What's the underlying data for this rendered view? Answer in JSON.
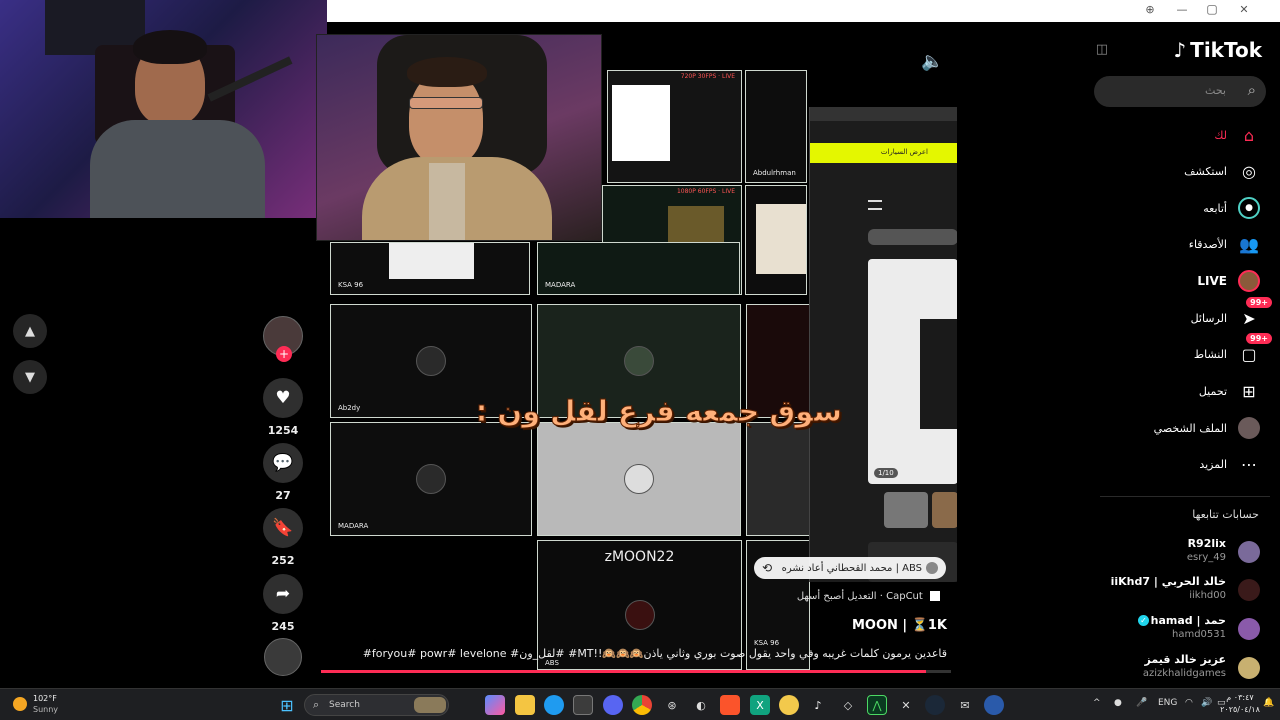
{
  "colors": {
    "accent": "#fe2c55",
    "sidebar_bg": "#000000",
    "taskbar_bg": "#1e1f22"
  },
  "window": {
    "controls": [
      "zoom-icon",
      "minimize-icon",
      "restore-icon",
      "close-icon"
    ]
  },
  "sidebar": {
    "logo": "TikTok",
    "search_placeholder": "بحث",
    "nav": [
      {
        "label": "لك",
        "icon": "home-icon",
        "active": true
      },
      {
        "label": "استكشف",
        "icon": "compass-icon"
      },
      {
        "label": "أتابعه",
        "icon": "following-icon"
      },
      {
        "label": "الأصدقاء",
        "icon": "friends-icon"
      },
      {
        "label": "LIVE",
        "icon": "live-icon"
      },
      {
        "label": "الرسائل",
        "icon": "messages-icon",
        "badge": "99+"
      },
      {
        "label": "النشاط",
        "icon": "activity-icon",
        "badge": "99+"
      },
      {
        "label": "تحميل",
        "icon": "upload-icon"
      },
      {
        "label": "الملف الشخصي",
        "icon": "profile-icon"
      },
      {
        "label": "المزيد",
        "icon": "more-icon"
      }
    ],
    "following_title": "حسابات تتابعها",
    "following": [
      {
        "name": "R92lix",
        "user": "esry_49"
      },
      {
        "name": "خالد الحربي | iiKhd7",
        "user": "iikhd00"
      },
      {
        "name": "حمد | hamad",
        "user": "hamd0531",
        "verified": true
      },
      {
        "name": "عزيز خالد قيمز",
        "user": "azizkhalidgames"
      }
    ]
  },
  "video": {
    "headline": "سوق جمعه فرع لقل ون :",
    "tiles": [
      "Ab2dy",
      "MADARA",
      "Abdulrhman",
      "MADARA",
      "KSA 96",
      "zMOON22",
      "ABS",
      "KSA 96"
    ],
    "phone_counter": "1/10",
    "phone_banner": "اعرض السيارات",
    "overlay_tags": [
      "720P 30FPS · LIVE",
      "1080P 60FPS · LIVE",
      "SOURCE 60FPS · LIVE"
    ]
  },
  "actions": {
    "likes": "1254",
    "comments": "27",
    "saves": "252",
    "shares": "245"
  },
  "caption": {
    "repost": "ABS | محمد القحطاني أعاد نشره",
    "capcut": "CapCut · التعديل أصبح أسهل",
    "author": "MOON | ⏳1K",
    "text": "قاعدين يرمون كلمات غريبه وفي واحد يقول صوت بوري وثاني ياذن🙉🙉🙉!!MT#  #لقل_ون# foryou# powr# levelone#"
  },
  "taskbar": {
    "weather_temp": "102°F",
    "weather_text": "Sunny",
    "search_label": "Search",
    "lang": "ENG",
    "time": "٠٣:٤٧ م",
    "date": "٢٠٢٥/٠٤/١٨"
  }
}
